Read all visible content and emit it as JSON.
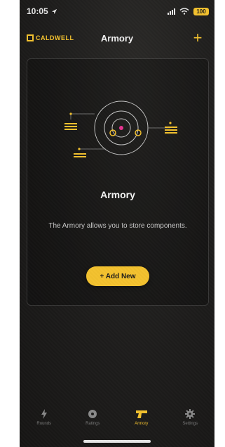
{
  "status": {
    "time": "10:05",
    "battery": "100"
  },
  "header": {
    "logo_text": "CALDWELL",
    "title": "Armory"
  },
  "empty_state": {
    "title": "Armory",
    "description": "The Armory allows you to store components.",
    "add_button_label": "+ Add New"
  },
  "tabs": [
    {
      "label": "Rounds",
      "icon": "bolt-icon",
      "active": false
    },
    {
      "label": "Ratings",
      "icon": "target-icon",
      "active": false
    },
    {
      "label": "Armory",
      "icon": "pistol-icon",
      "active": true
    },
    {
      "label": "Settings",
      "icon": "gear-icon",
      "active": false
    }
  ],
  "colors": {
    "accent": "#f3c12e",
    "background": "#1d1c1b",
    "inactive": "#7a7a7a"
  }
}
